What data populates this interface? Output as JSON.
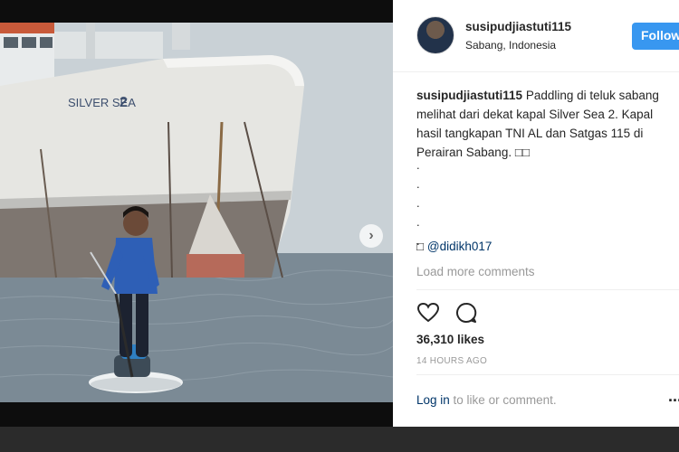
{
  "post": {
    "username": "susipudjiastuti115",
    "location": "Sabang, Indonesia",
    "follow_label": "Follow",
    "caption_text": "Paddling di teluk sabang melihat dari dekat kapal Silver Sea 2. Kapal hasil tangkapan TNI AL dan Satgas 115 di Perairan Sabang. □□",
    "caption_dots": [
      ".",
      ".",
      ".",
      ".",
      "."
    ],
    "mention_glyph": "□",
    "mention": "@didikh017",
    "load_more": "Load more comments",
    "likes": "36,310 likes",
    "time_ago": "14 HOURS AGO",
    "login_link": "Log in",
    "login_rest": " to like or comment.",
    "options_glyph": "..."
  },
  "photo": {
    "ship_name": "SILVER SEA",
    "ship_number": "2",
    "next_glyph": "›"
  },
  "icons": {
    "like": "heart-icon",
    "comment": "comment-icon",
    "next": "chevron-right-icon"
  },
  "colors": {
    "follow_button": "#3897f0",
    "link": "#003569",
    "muted": "#999999"
  }
}
